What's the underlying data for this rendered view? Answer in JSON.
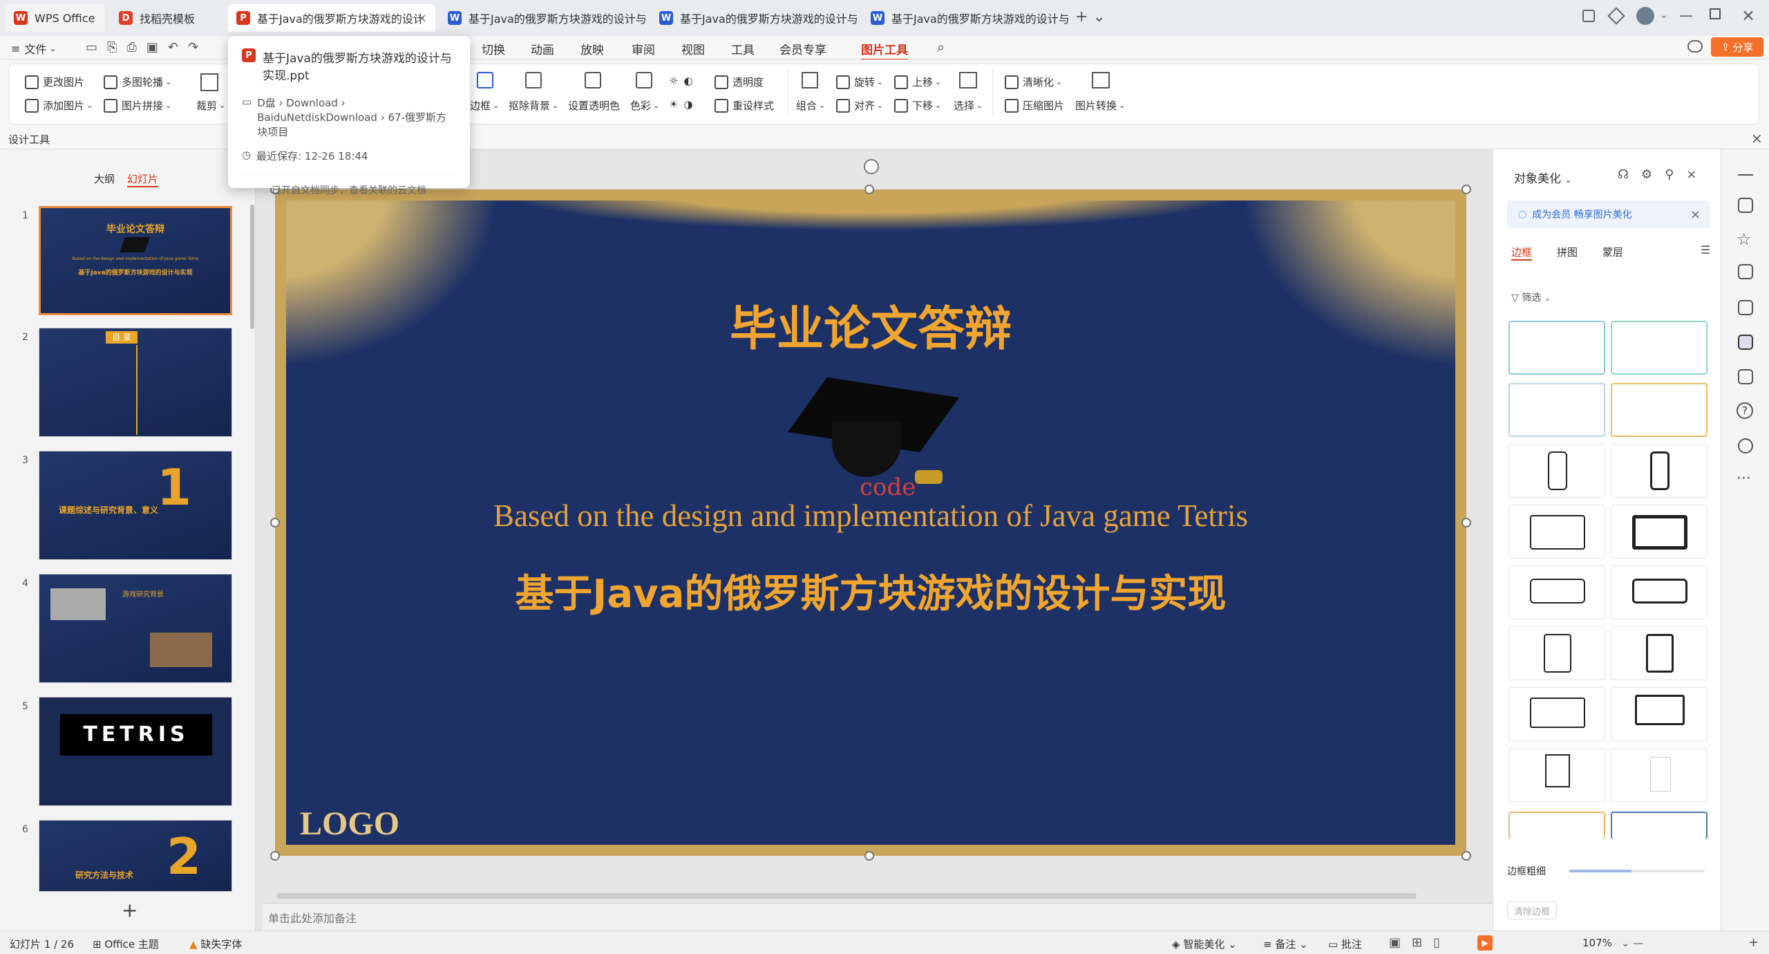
{
  "tabs": [
    {
      "label": "WPS Office",
      "icon": "wps-logo-icon",
      "color": "#d6361c"
    },
    {
      "label": "找稻壳模板",
      "icon": "docer-icon",
      "color": "#e0402a"
    },
    {
      "label": "基于Java的俄罗斯方块游戏的设计",
      "icon": "ppt-icon",
      "color": "#d6361c"
    },
    {
      "label": "基于Java的俄罗斯方块游戏的设计与实",
      "icon": "word-icon",
      "color": "#2b5cd6"
    },
    {
      "label": "基于Java的俄罗斯方块游戏的设计与实",
      "icon": "word-icon",
      "color": "#2b5cd6"
    },
    {
      "label": "基于Java的俄罗斯方块游戏的设计与实",
      "icon": "word-icon",
      "color": "#2b5cd6"
    }
  ],
  "menu": {
    "file": "文件",
    "items": [
      "切换",
      "动画",
      "放映",
      "审阅",
      "视图",
      "工具",
      "会员专享",
      "图片工具"
    ],
    "share": "分享"
  },
  "ribbon": {
    "change_pic": "更改图片",
    "multi_carousel": "多图轮播",
    "add_pic": "添加图片",
    "pic_splice": "图片拼接",
    "crop": "裁剪",
    "border": "边框",
    "remove_bg": "抠除背景",
    "set_transparent": "设置透明色",
    "color": "色彩",
    "transparency": "透明度",
    "reset_style": "重设样式",
    "group": "组合",
    "align": "对齐",
    "rotate": "旋转",
    "move_up": "上移",
    "move_down": "下移",
    "select": "选择",
    "clarify": "清晰化",
    "compress": "压缩图片",
    "convert": "图片转换"
  },
  "design_tools": "设计工具",
  "popup": {
    "title": "基于Java的俄罗斯方块游戏的设计与实现.ppt",
    "path": "D盘 › Download › BaiduNetdiskDownload › 67-俄罗斯方块项目",
    "saved": "最近保存: 12-26 18:44",
    "sync": "已开启文档同步，查看关联的云文档"
  },
  "left": {
    "outline_tab": "大纲",
    "slides_tab": "幻灯片",
    "add": "+",
    "thumbs": [
      {
        "n": "1",
        "title": "毕业论文答辩",
        "sub": "Based on the design and implementation of Java game Tetris",
        "sub2": "基于Java的俄罗斯方块游戏的设计与实现"
      },
      {
        "n": "2",
        "title": "目 录"
      },
      {
        "n": "3",
        "title": "课题综述与研究背景、意义",
        "big": "1"
      },
      {
        "n": "4",
        "title": "游戏研究背景"
      },
      {
        "n": "5",
        "title": "TETRIS"
      },
      {
        "n": "6",
        "title": "研究方法与技术",
        "big": "2"
      }
    ]
  },
  "slide": {
    "title": "毕业论文答辩",
    "en": "Based on the design and implementation of Java game Tetris",
    "zh": "基于Java的俄罗斯方块游戏的设计与实现",
    "logo": "LOGO",
    "watermark": "code"
  },
  "notes_placeholder": "单击此处添加备注",
  "right": {
    "header": "对象美化",
    "promo": "成为会员 畅享图片美化",
    "tabs": [
      "边框",
      "拼图",
      "蒙层"
    ],
    "filter": "筛选",
    "border_weight": "边框粗细",
    "clear_border": "清除边框"
  },
  "status": {
    "slide": "幻灯片 1 / 26",
    "theme": "Office 主题",
    "missing_font": "缺失字体",
    "beautify": "智能美化",
    "notes": "备注",
    "comments": "批注",
    "zoom": "107%"
  }
}
